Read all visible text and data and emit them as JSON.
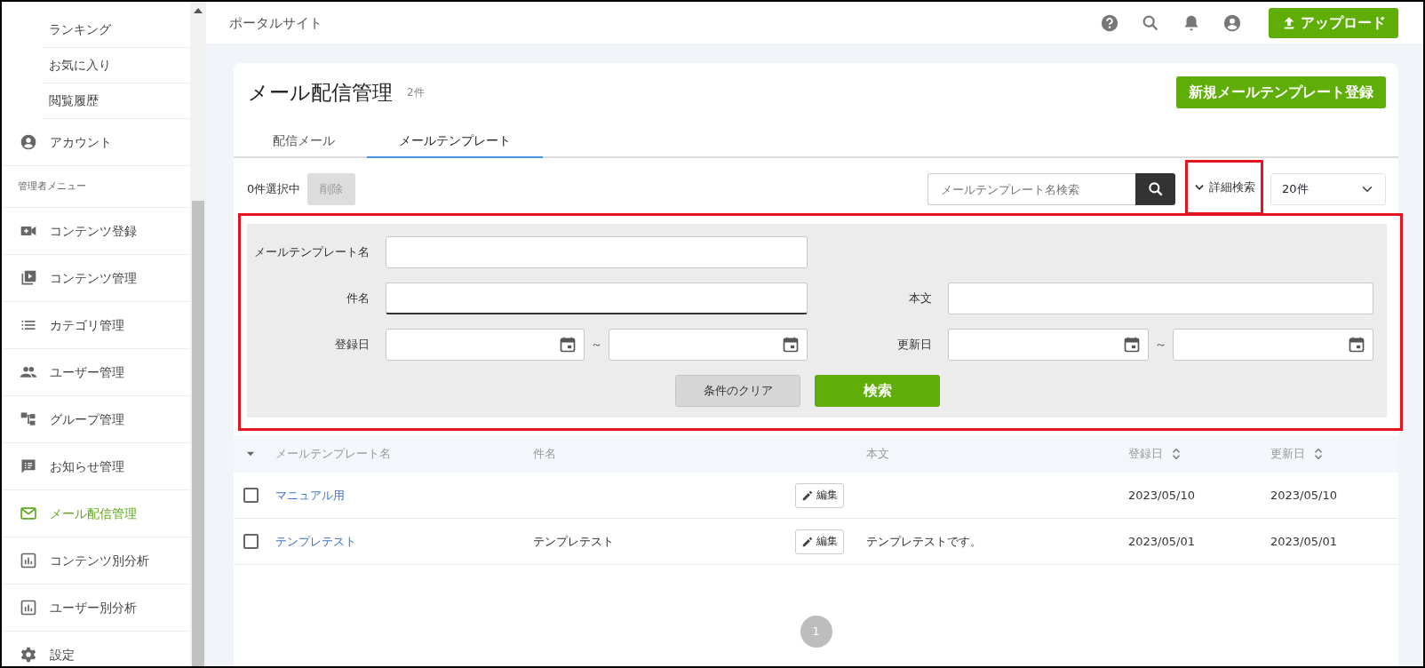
{
  "sidebar": {
    "items": [
      {
        "kind": "sub",
        "label": "ランキング",
        "selected": false
      },
      {
        "kind": "sub",
        "label": "お気に入り",
        "selected": false
      },
      {
        "kind": "sub",
        "label": "閲覧履歴",
        "selected": false
      },
      {
        "kind": "item",
        "label": "アカウント",
        "selected": false
      },
      {
        "kind": "section",
        "label": "管理者メニュー"
      },
      {
        "kind": "item",
        "label": "コンテンツ登録",
        "selected": false
      },
      {
        "kind": "item",
        "label": "コンテンツ管理",
        "selected": false
      },
      {
        "kind": "item",
        "label": "カテゴリ管理",
        "selected": false
      },
      {
        "kind": "item",
        "label": "ユーザー管理",
        "selected": false
      },
      {
        "kind": "item",
        "label": "グループ管理",
        "selected": false
      },
      {
        "kind": "item",
        "label": "お知らせ管理",
        "selected": false
      },
      {
        "kind": "item",
        "label": "メール配信管理",
        "selected": true
      },
      {
        "kind": "item",
        "label": "コンテンツ別分析",
        "selected": false
      },
      {
        "kind": "item",
        "label": "ユーザー別分析",
        "selected": false
      },
      {
        "kind": "item",
        "label": "設定",
        "selected": false
      }
    ]
  },
  "header": {
    "title": "ポータルサイト",
    "upload_button": "アップロード"
  },
  "page": {
    "title": "メール配信管理",
    "count": "2件",
    "new_button": "新規メールテンプレート登録"
  },
  "tabs": [
    {
      "label": "配信メール",
      "selected": false
    },
    {
      "label": "メールテンプレート",
      "selected": true
    }
  ],
  "toolbar": {
    "selection": "0件選択中",
    "delete_button": {
      "label": "削除",
      "disabled": true
    },
    "search": {
      "placeholder": "メールテンプレート名検索"
    },
    "detail_toggle": {
      "label": "詳細検索",
      "expanded": true
    },
    "page_size": "20件"
  },
  "detail_search": {
    "fields": [
      {
        "kind": "text",
        "label": "メールテンプレート名",
        "focused": false
      },
      {
        "kind": "text",
        "label": "件名",
        "focused": true
      },
      {
        "kind": "text",
        "label": "本文",
        "focused": false
      },
      {
        "kind": "date_range",
        "label": "登録日",
        "separator": "～"
      },
      {
        "kind": "date_range",
        "label": "更新日",
        "separator": "～"
      }
    ],
    "clear_button": "条件のクリア",
    "search_button": "検索"
  },
  "table": {
    "columns": [
      {
        "label": "メールテンプレート名",
        "sortable": false
      },
      {
        "label": "件名",
        "sortable": false
      },
      {
        "label": "本文",
        "sortable": false
      },
      {
        "label": "登録日",
        "sortable": true
      },
      {
        "label": "更新日",
        "sortable": true
      }
    ],
    "rows": [
      {
        "checked": false,
        "name": "マニュアル用",
        "edit_button": "編集",
        "registered": "2023/05/10",
        "updated": "2023/05/10"
      },
      {
        "checked": false,
        "name": "テンプレテスト",
        "subject": "テンプレテスト",
        "edit_button": "編集",
        "body": "テンプレテストです。",
        "registered": "2023/05/01",
        "updated": "2023/05/01"
      }
    ]
  },
  "pagination": [
    {
      "label": "1",
      "selected": true
    }
  ]
}
